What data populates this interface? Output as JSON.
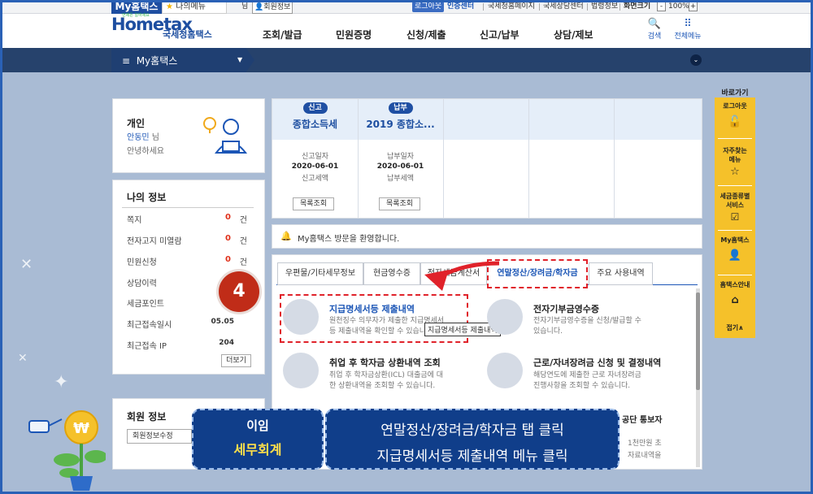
{
  "util": {
    "tab_my": "My홈택스",
    "tab_fav": "나의메뉴",
    "greeting_suffix": "님",
    "member_info": "회원정보",
    "logout": "로그아웃",
    "cert_center": "인증센터",
    "links": [
      "국세청홈페이지",
      "국세상담센터",
      "법령정보"
    ],
    "screen_size": "화면크기",
    "zoom_minus": "-",
    "zoom_value": "100%",
    "zoom_plus": "+"
  },
  "header": {
    "logo": "Hometax",
    "logo_small": "언제든 일하세요",
    "logo_kr": "국세청홈택스",
    "menu": [
      "조회/발급",
      "민원증명",
      "신청/제출",
      "신고/납부",
      "상담/제보"
    ],
    "search_label": "검색",
    "all_menu_label": "전체메뉴"
  },
  "nav": {
    "title": "My홈택스"
  },
  "profile": {
    "type": "개인",
    "name": "안동민",
    "name_suffix": "님",
    "greeting": "안녕하세요"
  },
  "myinfo": {
    "title": "나의 정보",
    "rows": [
      {
        "label": "쪽지",
        "value": "0",
        "unit": "건"
      },
      {
        "label": "전자고지 미열람",
        "value": "0",
        "unit": "건"
      },
      {
        "label": "민원신청",
        "value": "0",
        "unit": "건"
      },
      {
        "label": "상담이력",
        "value": "",
        "unit": ""
      },
      {
        "label": "세금포인트",
        "value": "",
        "unit": ""
      },
      {
        "label": "최근접속일시",
        "value": "05.05",
        "unit": ""
      },
      {
        "label": "최근접속 IP",
        "value": "204",
        "unit": ""
      }
    ],
    "more": "더보기"
  },
  "member": {
    "title": "회원 정보",
    "edit": "회원정보수정"
  },
  "cards": [
    {
      "badge": "신고",
      "title": "종합소득세",
      "date_label": "신고일자",
      "date": "2020-06-01",
      "amount_label": "신고세액",
      "button": "목록조회"
    },
    {
      "badge": "납부",
      "title": "2019 종합소...",
      "date_label": "납부일자",
      "date": "2020-06-01",
      "amount_label": "납부세액",
      "button": "목록조회"
    }
  ],
  "notice": "My홈택스 방문을 환영합니다.",
  "tabs": [
    "우편물/기타세무정보",
    "현금영수증",
    "전자세금계산서",
    "연말정산/장려금/학자금",
    "주요 사용내역"
  ],
  "menu_items": [
    {
      "title": "지급명세서등 제출내역",
      "desc1": "원천징수 의무자가 제출한 지급명세서",
      "desc2": "등 제출내역을 확인할 수 있습니다."
    },
    {
      "title": "전자기부금영수증",
      "desc1": "전자기부금영수증을 신청/발급할 수",
      "desc2": "있습니다."
    },
    {
      "title": "취업 후 학자금 상환내역 조회",
      "desc1": "취업 후 학자금상환(ICL) 대출금에 대",
      "desc2": "한 상환내역을 조회할 수 있습니다."
    },
    {
      "title": "근로/자녀장려금 신청 및 결정내역",
      "desc1": "해당연도에 제출한 근로 자녀장려금",
      "desc2": "진행사항을 조회할 수 있습니다."
    },
    {
      "title": "공단 통보자",
      "desc1": "1천만원 초",
      "desc2": "자료내역을"
    }
  ],
  "tooltip": "지급명세서등 제출내역",
  "quick": {
    "title": "바로가기",
    "items": [
      "로그아웃",
      "자주찾는 메뉴",
      "세금종류별 서비스",
      "My홈택스",
      "홈택스안내"
    ],
    "fold": "접기∧"
  },
  "step_number": "4",
  "overlay": {
    "brand1": "이임",
    "brand2": "세무회계",
    "line1": "연말정산/장려금/학자금 탭 클릭",
    "line2": "지급명세서등 제출내역 메뉴 클릭"
  },
  "colors": {
    "brand_blue": "#1d4ea0",
    "nav_dark": "#26426c",
    "bg": "#a9bbd4",
    "accent_red": "#e0321c",
    "quick_yellow": "#f5c12a"
  }
}
